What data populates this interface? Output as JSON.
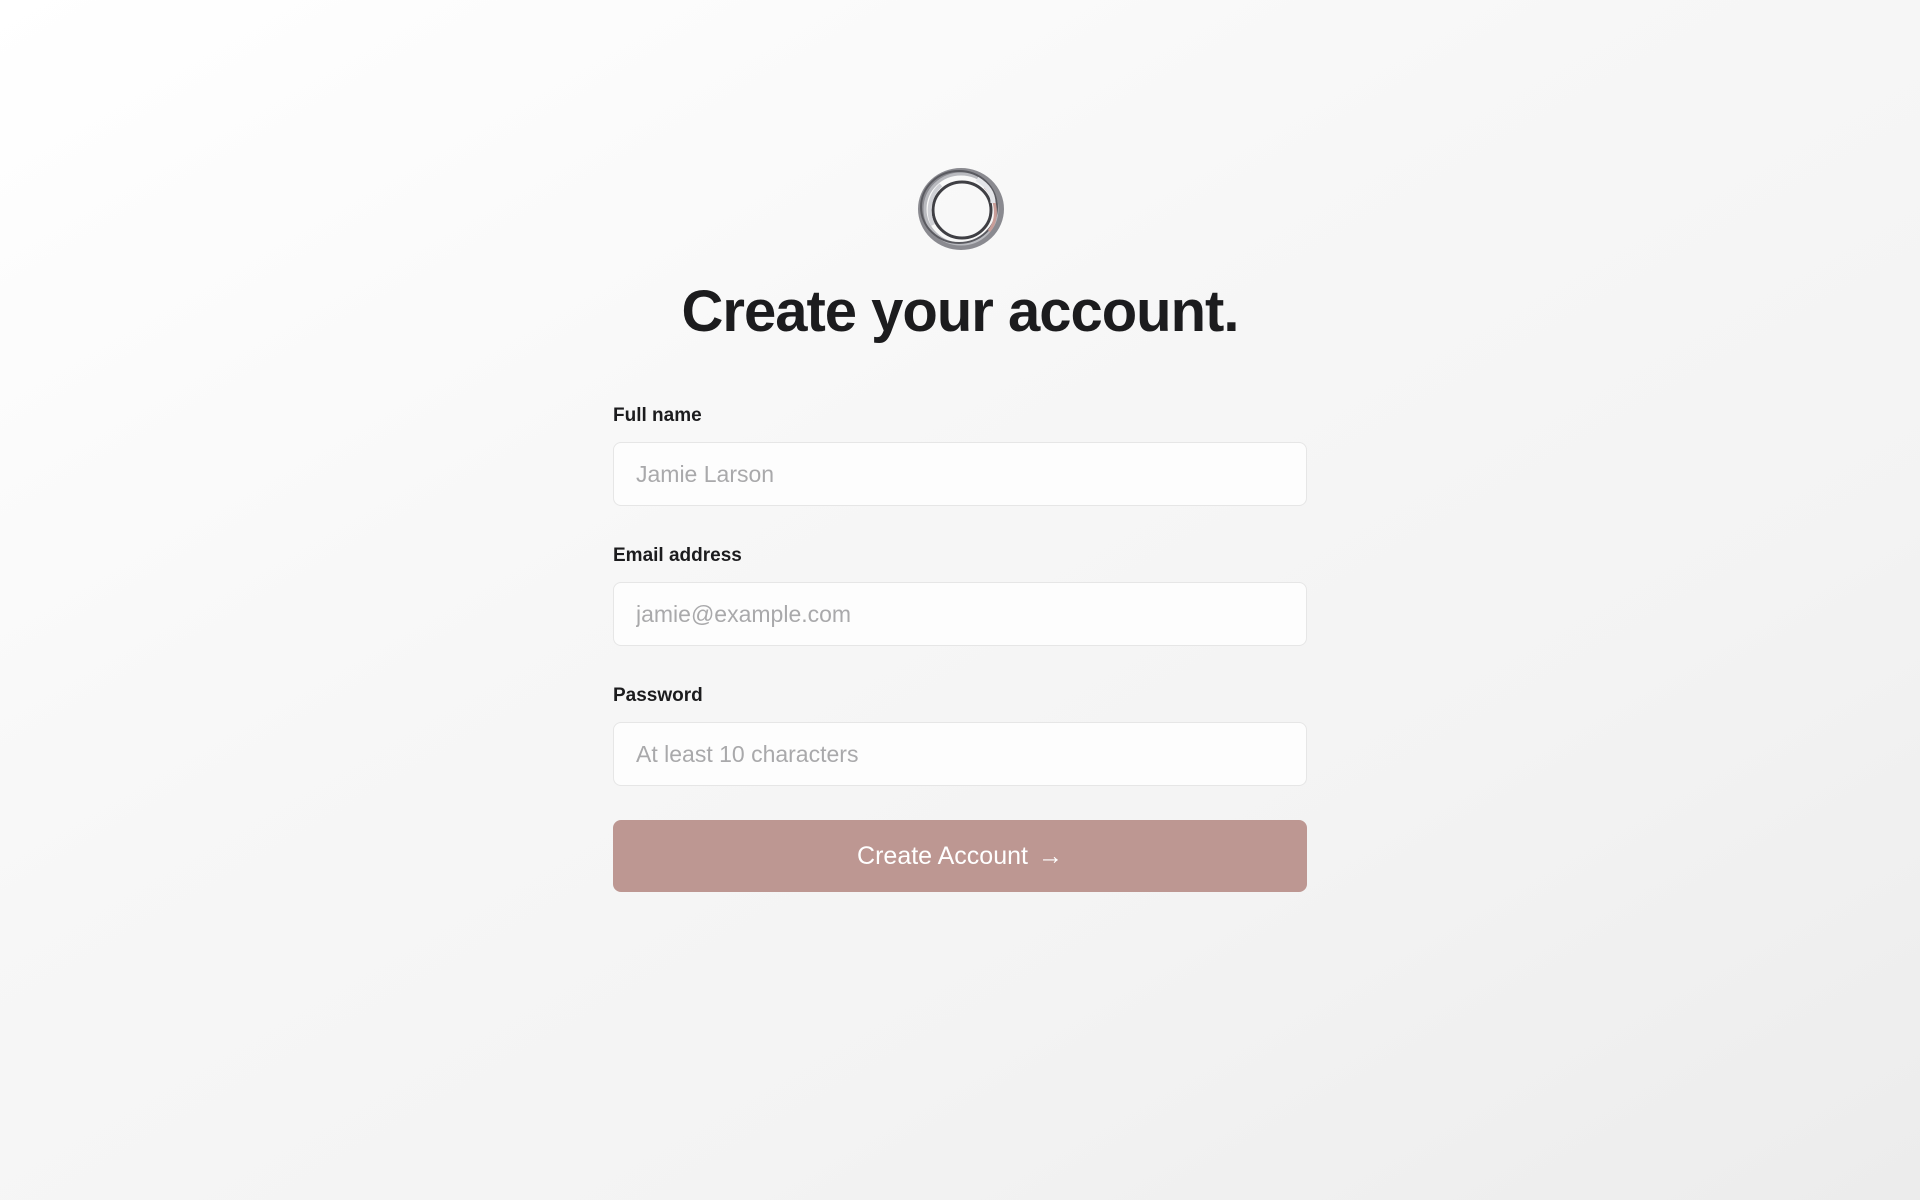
{
  "logo": {
    "icon": "ring-logo-icon"
  },
  "header": {
    "title": "Create your account."
  },
  "form": {
    "full_name": {
      "label": "Full name",
      "placeholder": "Jamie Larson",
      "value": ""
    },
    "email": {
      "label": "Email address",
      "placeholder": "jamie@example.com",
      "value": ""
    },
    "password": {
      "label": "Password",
      "placeholder": "At least 10 characters",
      "value": ""
    },
    "submit": {
      "label": "Create Account",
      "icon": "arrow-right-icon",
      "arrow": "→"
    }
  },
  "colors": {
    "button_bg": "#bd9792",
    "text": "#1c1c1e",
    "placeholder": "#a9a9ab",
    "input_border": "#e6e6e6"
  }
}
